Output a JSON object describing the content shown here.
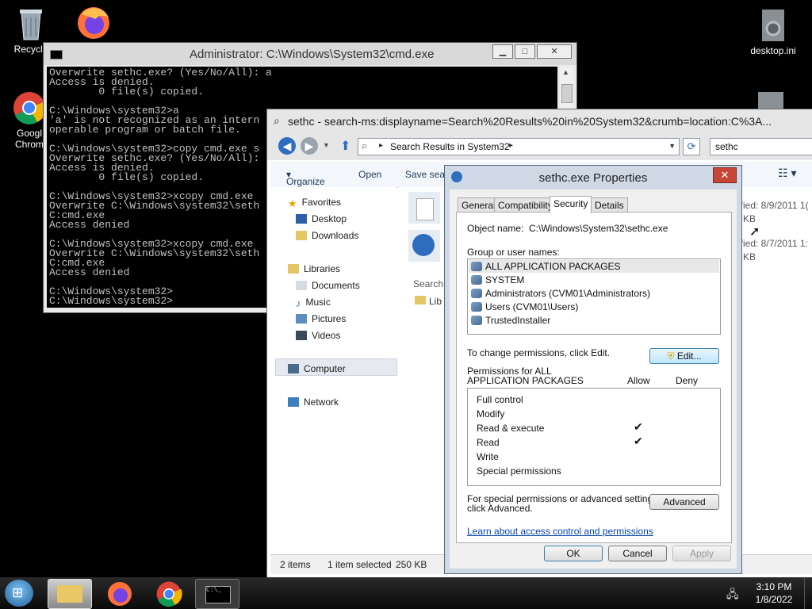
{
  "desktop": {
    "icons": [
      {
        "label": "Recycle",
        "icon": "recycle-bin-icon"
      },
      {
        "label": "",
        "icon": "firefox-icon"
      },
      {
        "label": "Googl Chrom",
        "icon": "chrome-icon"
      },
      {
        "label": "desktop.ini",
        "icon": "settings-file-icon"
      }
    ]
  },
  "cmd": {
    "title": "Administrator: C:\\Windows\\System32\\cmd.exe",
    "lines": "Overwrite sethc.exe? (Yes/No/All): a\nAccess is denied.\n        0 file(s) copied.\n\nC:\\Windows\\system32>a\n'a' is not recognized as an intern\noperable program or batch file.\n\nC:\\Windows\\system32>copy cmd.exe s\nOverwrite sethc.exe? (Yes/No/All):\nAccess is denied.\n        0 file(s) copied.\n\nC:\\Windows\\system32>xcopy cmd.exe\nOverwrite C:\\Windows\\system32\\seth\nC:cmd.exe\nAccess denied\n\nC:\\Windows\\system32>xcopy cmd.exe\nOverwrite C:\\Windows\\system32\\seth\nC:cmd.exe\nAccess denied\n\nC:\\Windows\\system32>\nC:\\Windows\\system32>"
  },
  "explorer": {
    "title": "sethc - search-ms:displayname=Search%20Results%20in%20System32&crumb=location:C%3A...",
    "address": "Search Results in System32",
    "search_value": "sethc",
    "toolbar": {
      "organize": "Organize",
      "open": "Open",
      "search": "Save sear"
    },
    "nav": {
      "favorites": "Favorites",
      "desktop": "Desktop",
      "downloads": "Downloads",
      "libraries": "Libraries",
      "documents": "Documents",
      "music": "Music",
      "pictures": "Pictures",
      "videos": "Videos",
      "computer": "Computer",
      "network": "Network"
    },
    "content": {
      "modified1": "ified: 8/9/2011 1(",
      "size1": "KB",
      "modified2": "ified: 8/7/2011 1:",
      "size2": "KB",
      "search_again": "Search",
      "lib": "Lib"
    },
    "status": {
      "items": "2 items",
      "selected": "1 item selected",
      "size": "250 KB"
    }
  },
  "props": {
    "title": "sethc.exe Properties",
    "tabs": [
      "General",
      "Compatibility",
      "Security",
      "Details"
    ],
    "object_label": "Object name:",
    "object_value": "C:\\Windows\\System32\\sethc.exe",
    "group_label": "Group or user names:",
    "users": [
      "ALL APPLICATION PACKAGES",
      "SYSTEM",
      "Administrators (CVM01\\Administrators)",
      "Users (CVM01\\Users)",
      "TrustedInstaller"
    ],
    "change_text": "To change permissions, click Edit.",
    "edit_button": "Edit...",
    "perm_label_1": "Permissions for ALL",
    "perm_label_2": "APPLICATION PACKAGES",
    "allow": "Allow",
    "deny": "Deny",
    "perms": [
      "Full control",
      "Modify",
      "Read & execute",
      "Read",
      "Write",
      "Special permissions"
    ],
    "check": "✔",
    "special_text_1": "For special permissions or advanced settings,",
    "special_text_2": "click Advanced.",
    "advanced_button": "Advanced",
    "learn_link": "Learn about access control and permissions",
    "ok": "OK",
    "cancel": "Cancel",
    "apply": "Apply"
  },
  "taskbar": {
    "time": "3:10 PM",
    "date": "1/8/2022",
    "cmd_icon_text": "C:\\_"
  }
}
